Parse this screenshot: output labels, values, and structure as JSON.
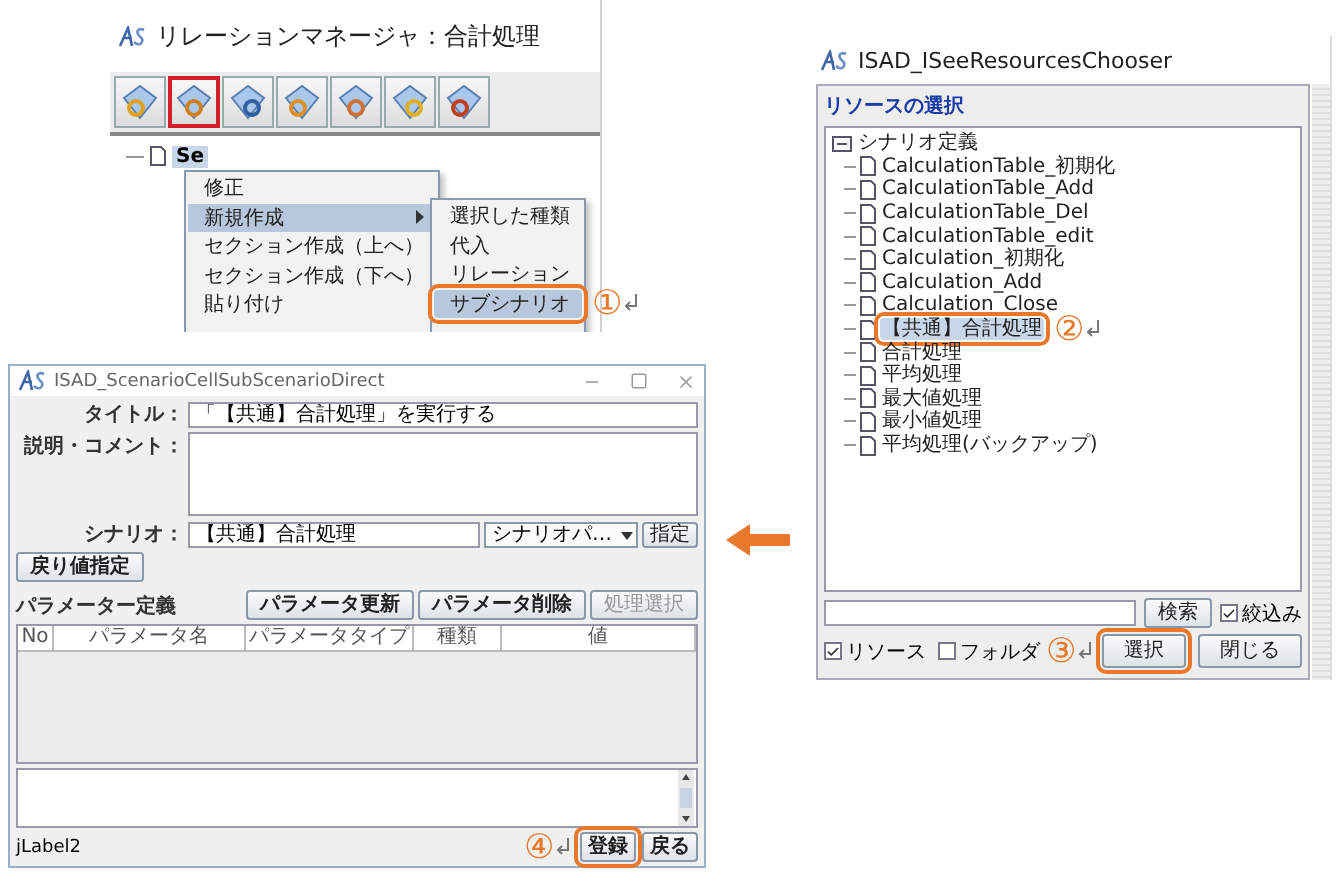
{
  "relation_manager": {
    "title": "リレーションマネージャ：合計処理",
    "toolbar": [
      {
        "selected": false
      },
      {
        "selected": true
      },
      {
        "selected": false
      },
      {
        "selected": false
      },
      {
        "selected": false
      },
      {
        "selected": false
      },
      {
        "selected": false
      }
    ],
    "tree": [
      {
        "label": "Se"
      }
    ],
    "context_menu": [
      {
        "label": "修正",
        "selected": false,
        "submenu": false
      },
      {
        "label": "新規作成",
        "selected": true,
        "submenu": true
      },
      {
        "label": "セクション作成（上へ）",
        "selected": false,
        "submenu": false
      },
      {
        "label": "セクション作成（下へ）",
        "selected": false,
        "submenu": false
      },
      {
        "label": "貼り付け",
        "selected": false,
        "submenu": false
      }
    ],
    "submenu": [
      {
        "label": "選択した種類",
        "selected": false
      },
      {
        "label": "代入",
        "selected": false
      },
      {
        "label": "リレーション",
        "selected": false
      },
      {
        "label": "サブシナリオ",
        "selected": true,
        "highlighted": true,
        "callout": "①"
      }
    ]
  },
  "resource_chooser": {
    "title": "ISAD_ISeeResourcesChooser",
    "heading": "リソースの選択",
    "tree": {
      "label": "シナリオ定義",
      "expanded": true,
      "children": [
        {
          "label": "CalculationTable_初期化",
          "selected": false
        },
        {
          "label": "CalculationTable_Add",
          "selected": false
        },
        {
          "label": "CalculationTable_Del",
          "selected": false
        },
        {
          "label": "CalculationTable_edit",
          "selected": false
        },
        {
          "label": "Calculation_初期化",
          "selected": false
        },
        {
          "label": "Calculation_Add",
          "selected": false
        },
        {
          "label": "Calculation_Close",
          "selected": false
        },
        {
          "label": "【共通】合計処理",
          "selected": true,
          "highlighted": true,
          "callout": "②"
        },
        {
          "label": "合計処理",
          "selected": false
        },
        {
          "label": "平均処理",
          "selected": false
        },
        {
          "label": "最大値処理",
          "selected": false
        },
        {
          "label": "最小値処理",
          "selected": false
        },
        {
          "label": "平均処理(バックアップ)",
          "selected": false
        }
      ]
    },
    "search_button": "検索",
    "filter": {
      "label": "絞込み",
      "checked": true
    },
    "options": [
      {
        "label": "リソース",
        "checked": true
      },
      {
        "label": "フォルダ",
        "checked": false
      }
    ],
    "buttons": [
      {
        "label": "選択",
        "highlighted": true,
        "callout": "③"
      },
      {
        "label": "閉じる",
        "highlighted": false
      }
    ]
  },
  "scenario_dialog": {
    "title": "ISAD_ScenarioCellSubScenarioDirect",
    "title_field": {
      "label": "タイトル：",
      "value": "「【共通】合計処理」を実行する"
    },
    "comment_field": {
      "label": "説明・コメント："
    },
    "scenario_field": {
      "label": "シナリオ：",
      "value": "【共通】合計処理",
      "select": "シナリオパ…",
      "button": "指定"
    },
    "return_button": "戻り値指定",
    "parameters": {
      "label": "パラメーター定義",
      "buttons": [
        {
          "label": "パラメータ更新",
          "disabled": false
        },
        {
          "label": "パラメータ削除",
          "disabled": false
        },
        {
          "label": "処理選択",
          "disabled": true
        }
      ],
      "columns": [
        "No",
        "パラメータ名",
        "パラメータタイプ",
        "種類",
        "値"
      ]
    },
    "status": "jLabel2",
    "buttons": [
      {
        "label": "登録",
        "highlighted": true,
        "callout": "④"
      },
      {
        "label": "戻る",
        "highlighted": false
      }
    ]
  }
}
